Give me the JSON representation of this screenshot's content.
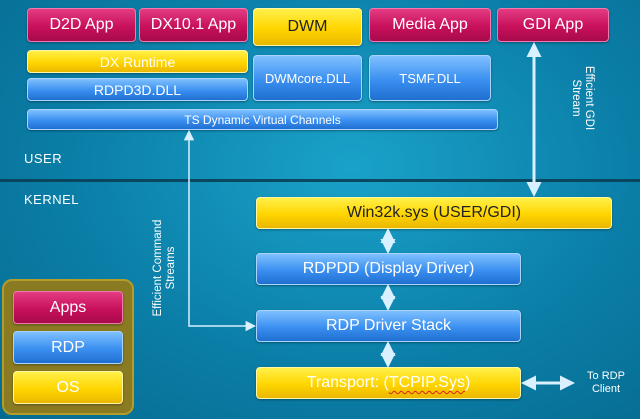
{
  "user_apps": {
    "d2d": "D2D App",
    "dx101": "DX10.1 App",
    "dwm": "DWM",
    "media": "Media App",
    "gdi": "GDI App"
  },
  "user_libs": {
    "dx_runtime": "DX Runtime",
    "rdpd3d": "RDPD3D.DLL",
    "dwmcore": "DWMcore.DLL",
    "tsmf": "TSMF.DLL",
    "ts_channels": "TS Dynamic Virtual Channels"
  },
  "sections": {
    "user": "USER",
    "kernel": "KERNEL"
  },
  "annotations": {
    "gdi_stream": [
      "Efficient GDI",
      "Stream"
    ],
    "command_streams": [
      "Efficient Command",
      "Streams"
    ],
    "to_rdp_client": [
      "To RDP",
      "Client"
    ]
  },
  "kernel_stack": {
    "win32k": "Win32k.sys (USER/GDI)",
    "rdpdd": "RDPDD (Display Driver)",
    "driver_stack": "RDP Driver Stack",
    "transport_prefix": "Transport: (",
    "transport_name": "TCPIP.Sys",
    "transport_suffix": ")"
  },
  "legend": {
    "apps": "Apps",
    "rdp": "RDP",
    "os": "OS"
  },
  "colors": {
    "apps": "#c8105b",
    "os": "#ffd500",
    "rdp": "#3a8ff0",
    "background": "#0b7fa8"
  }
}
